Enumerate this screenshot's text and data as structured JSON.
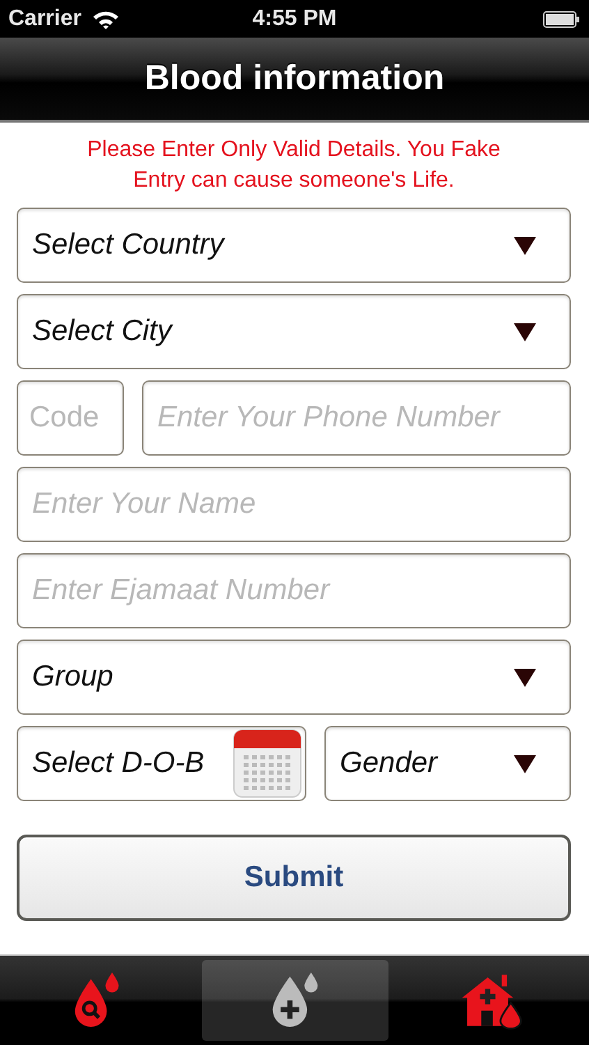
{
  "status_bar": {
    "carrier": "Carrier",
    "time": "4:55 PM"
  },
  "nav_bar": {
    "title": "Blood information"
  },
  "warning": "Please Enter Only Valid Details. You Fake Entry can cause someone's Life.",
  "form_rows": [
    {
      "fields": [
        {
          "kind": "select",
          "value": "Select Country"
        }
      ]
    },
    {
      "fields": [
        {
          "kind": "select",
          "value": "Select City"
        }
      ]
    },
    {
      "fields": [
        {
          "kind": "input",
          "placeholder": "Code"
        },
        {
          "kind": "input",
          "placeholder": "Enter Your Phone Number"
        }
      ]
    },
    {
      "fields": [
        {
          "kind": "input",
          "placeholder": "Enter Your Name"
        }
      ]
    },
    {
      "fields": [
        {
          "kind": "input",
          "placeholder": "Enter Ejamaat Number"
        }
      ]
    },
    {
      "fields": [
        {
          "kind": "select",
          "value": "Group"
        }
      ]
    },
    {
      "fields": [
        {
          "kind": "date",
          "value": "Select D-O-B"
        },
        {
          "kind": "select",
          "value": "Gender"
        }
      ]
    }
  ],
  "submit": "Submit",
  "tab_bar": [
    {
      "kind": "search",
      "selected": false
    },
    {
      "kind": "donate",
      "selected": true
    },
    {
      "kind": "home",
      "selected": false
    }
  ]
}
